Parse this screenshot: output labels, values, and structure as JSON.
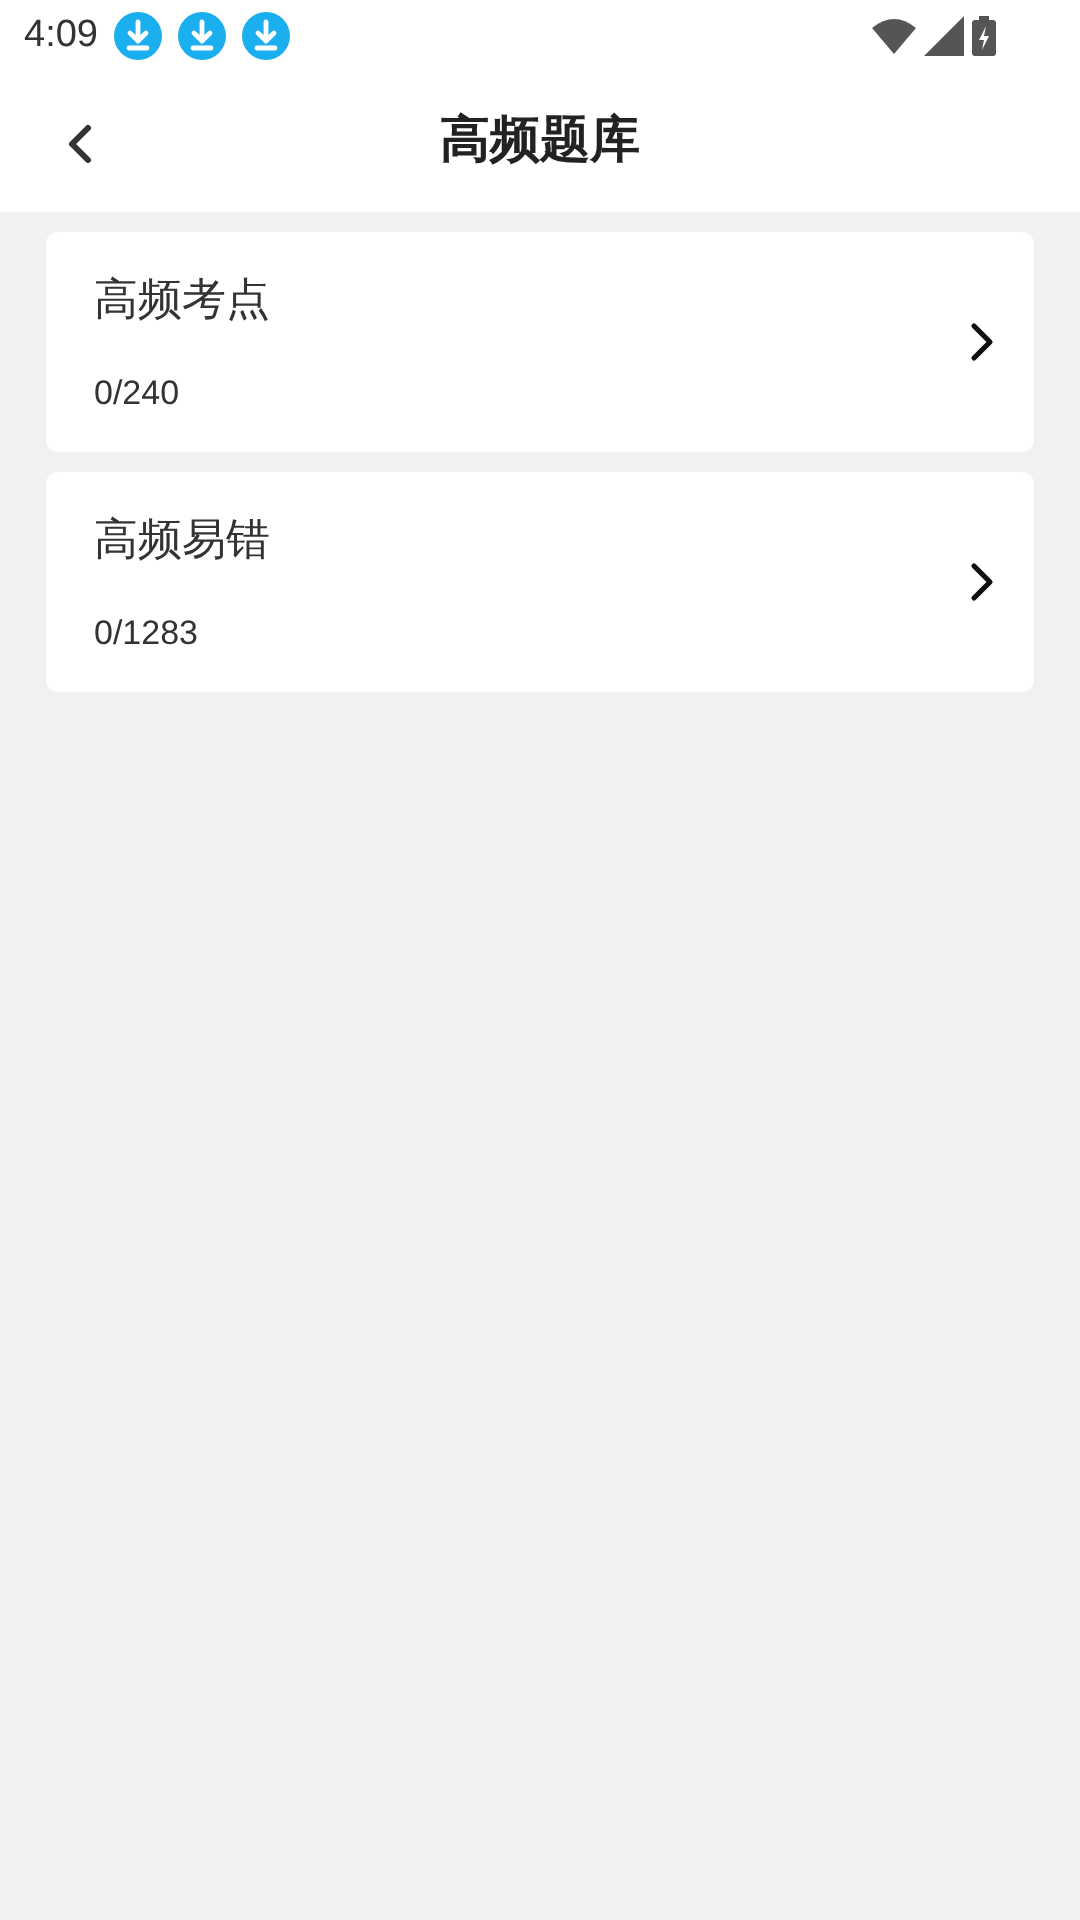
{
  "status_bar": {
    "time": "4:09"
  },
  "header": {
    "title": "高频题库"
  },
  "items": [
    {
      "title": "高频考点",
      "progress": "0/240"
    },
    {
      "title": "高频易错",
      "progress": "0/1283"
    }
  ]
}
